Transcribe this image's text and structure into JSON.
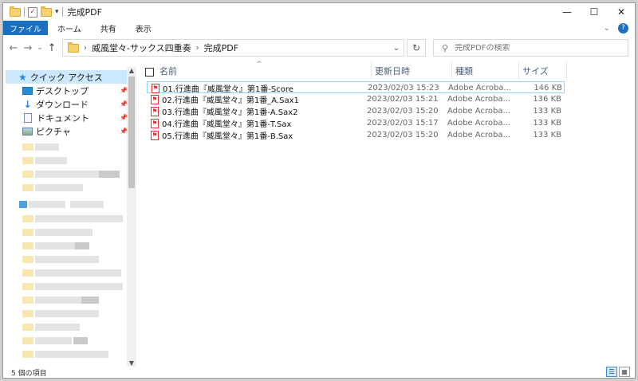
{
  "titlebar": {
    "title": "完成PDF",
    "minimize": "—",
    "maximize": "☐",
    "close": "✕"
  },
  "ribbon": {
    "tabs": [
      "ファイル",
      "ホーム",
      "共有",
      "表示"
    ]
  },
  "navbar": {
    "back": "←",
    "forward": "→",
    "recent": "⌄",
    "up": "↑",
    "breadcrumbs": [
      "威風堂々-サックス四重奏",
      "完成PDF"
    ],
    "search_placeholder": "完成PDFの検索"
  },
  "navpane": {
    "quick_access": "クイック アクセス",
    "items": [
      {
        "label": "デスクトップ",
        "icon": "desktop-icon"
      },
      {
        "label": "ダウンロード",
        "icon": "download-icon"
      },
      {
        "label": "ドキュメント",
        "icon": "document-icon"
      },
      {
        "label": "ピクチャ",
        "icon": "picture-icon"
      }
    ]
  },
  "columns": {
    "name": "名前",
    "date": "更新日時",
    "type": "種類",
    "size": "サイズ"
  },
  "files": [
    {
      "name": "01.行進曲『威風堂々』第1番-Score",
      "date": "2023/02/03 15:23",
      "type": "Adobe Acroba...",
      "size": "146 KB",
      "selected": true
    },
    {
      "name": "02.行進曲『威風堂々』第1番_A.Sax1",
      "date": "2023/02/03 15:21",
      "type": "Adobe Acroba...",
      "size": "136 KB"
    },
    {
      "name": "03.行進曲『威風堂々』第1番-A.Sax2",
      "date": "2023/02/03 15:20",
      "type": "Adobe Acroba...",
      "size": "133 KB"
    },
    {
      "name": "04.行進曲『威風堂々』第1番-T.Sax",
      "date": "2023/02/03 15:17",
      "type": "Adobe Acroba...",
      "size": "133 KB"
    },
    {
      "name": "05.行進曲『威風堂々』第1番-B.Sax",
      "date": "2023/02/03 15:20",
      "type": "Adobe Acroba...",
      "size": "133 KB"
    }
  ],
  "status": {
    "count": "5 個の項目"
  },
  "colors": {
    "accent": "#1a6fc0",
    "selection": "#cce8ff",
    "pdf_red": "#d33"
  }
}
